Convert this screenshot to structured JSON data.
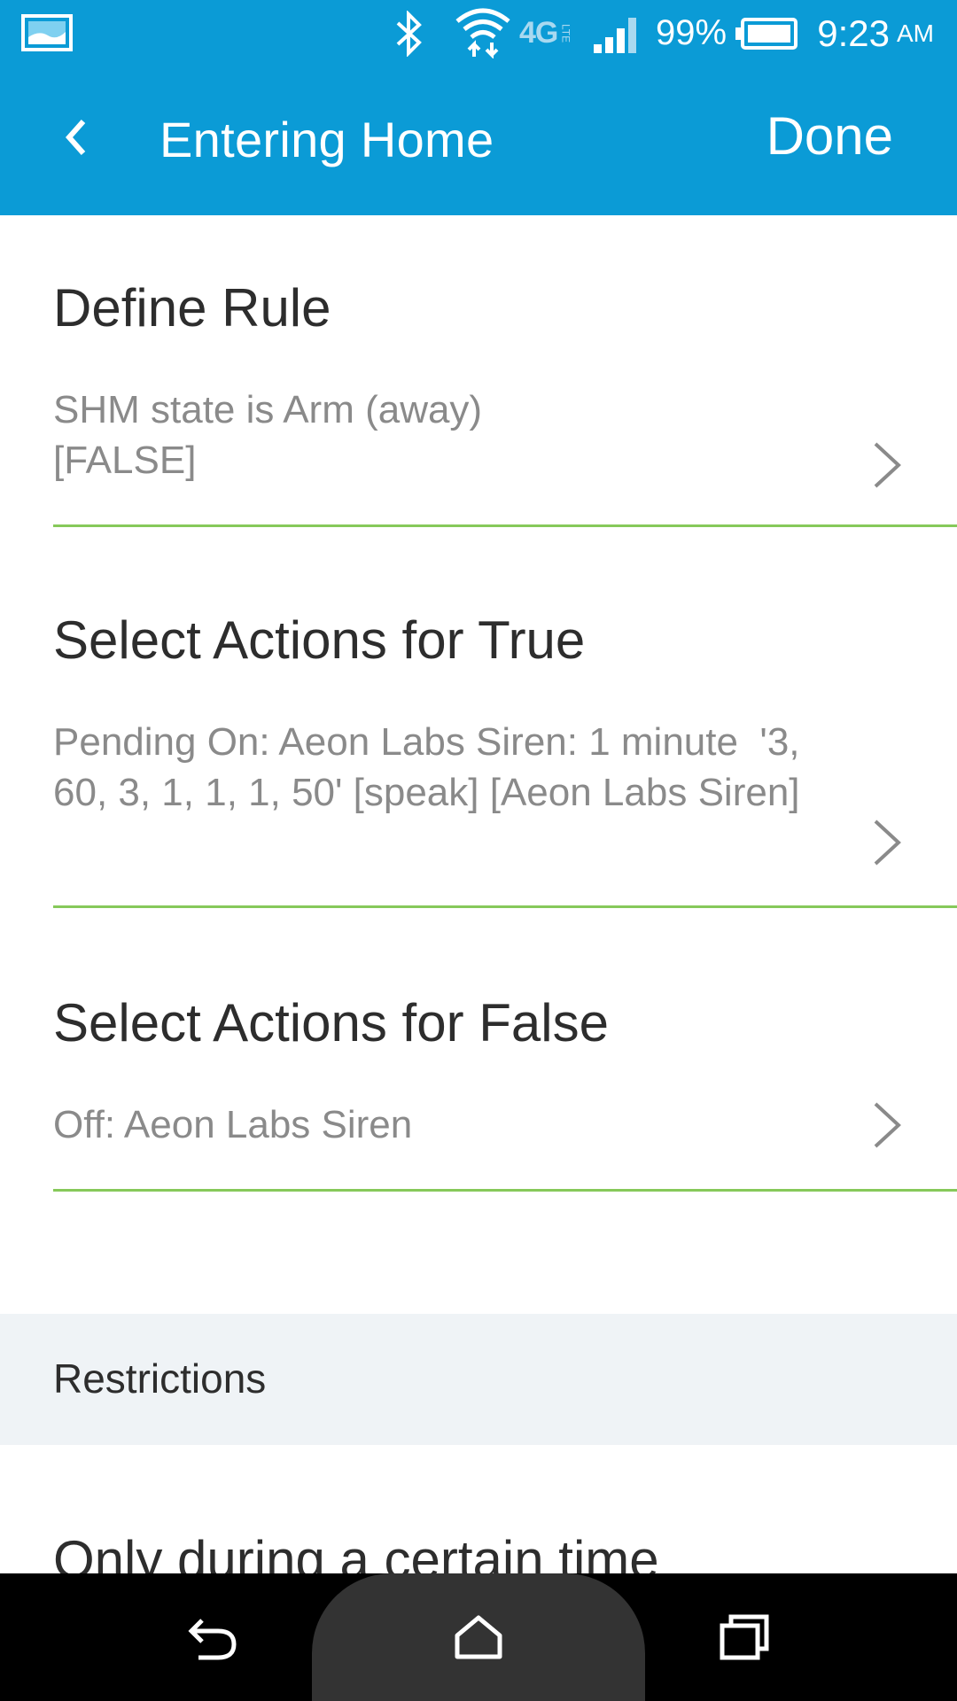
{
  "status_bar": {
    "icons": [
      "gallery-icon",
      "bluetooth-icon",
      "wifi-icon",
      "lte-4g-icon",
      "signal-icon",
      "battery-icon"
    ],
    "network_label": "4G",
    "battery_percent": "99%",
    "time": "9:23",
    "ampm": "AM"
  },
  "app_bar": {
    "back_icon": "chevron-left-icon",
    "title": "Entering Home",
    "done_label": "Done"
  },
  "sections": [
    {
      "heading": "Define Rule",
      "description": "SHM state is Arm (away) [FALSE]"
    },
    {
      "heading": "Select Actions for True",
      "description": "Pending On: Aeon Labs Siren: 1 minute  '3, 60, 3, 1, 1, 1, 50' [speak] [Aeon Labs Siren]"
    },
    {
      "heading": "Select Actions for False",
      "description": "Off: Aeon Labs Siren"
    }
  ],
  "restrictions": {
    "label": "Restrictions",
    "first_item": "Only during a certain time"
  },
  "nav_bar": {
    "icons": [
      "back-nav-icon",
      "home-nav-icon",
      "recents-nav-icon"
    ]
  },
  "colors": {
    "primary": "#0b9bd6",
    "divider": "#86c95a",
    "band": "#eff3f6"
  }
}
